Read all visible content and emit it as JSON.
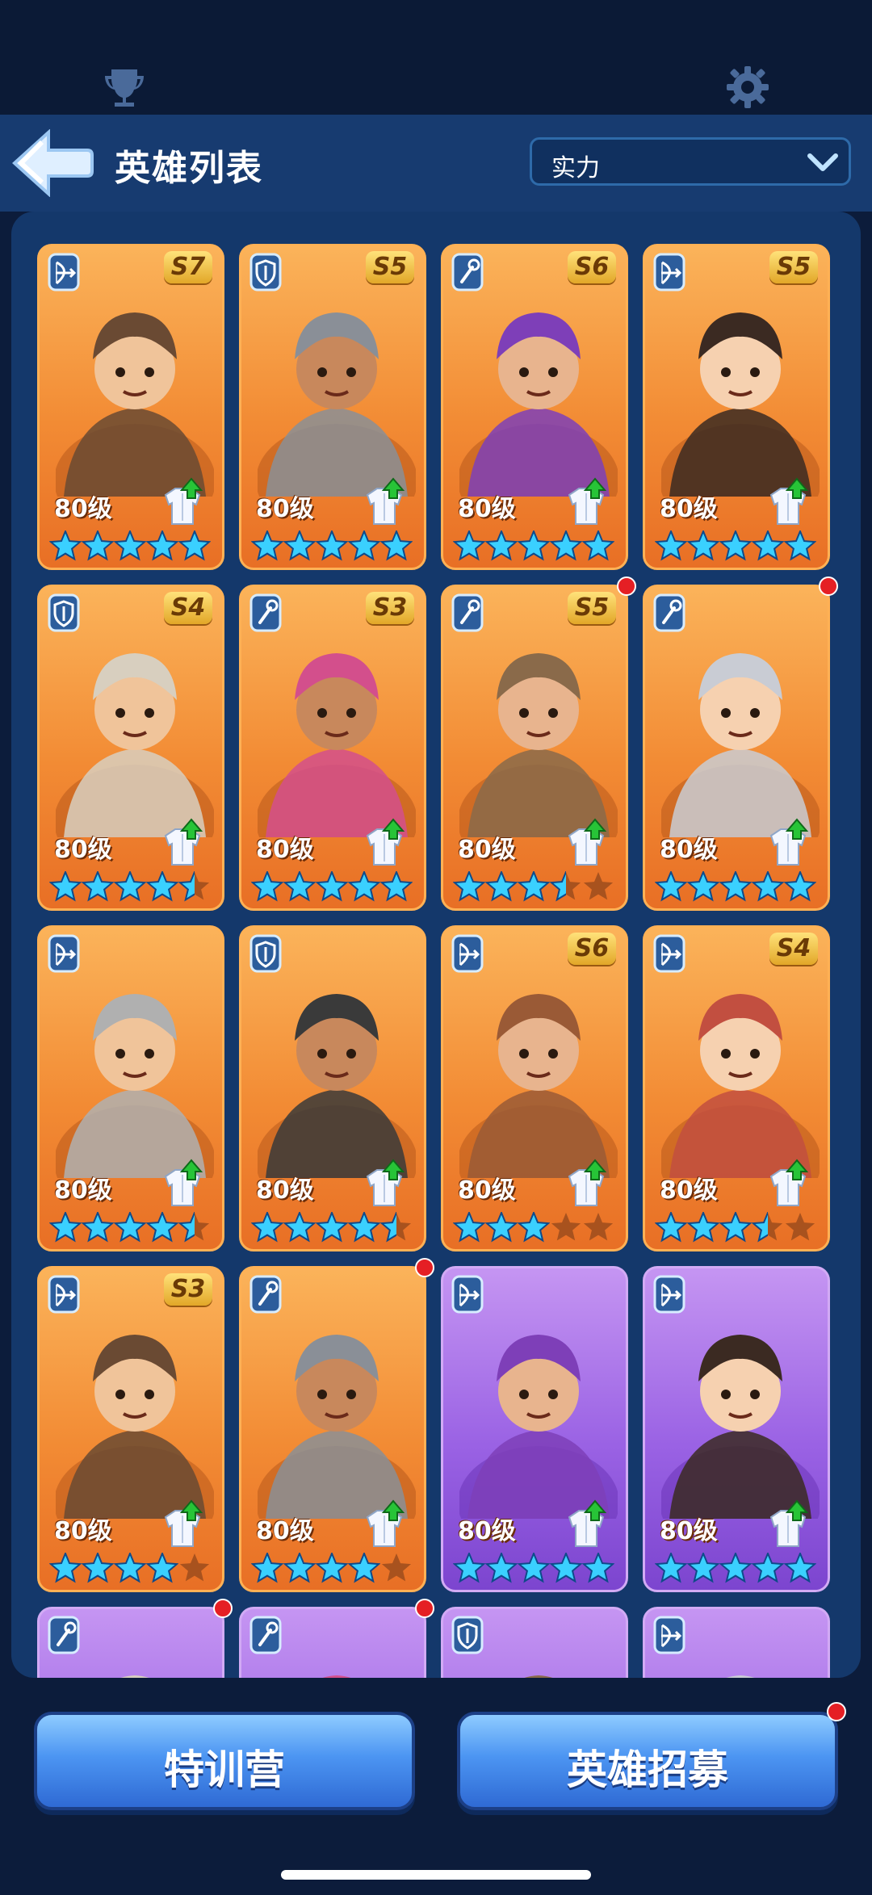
{
  "header": {
    "title": "英雄列表",
    "sort_value": "实力"
  },
  "buttons": {
    "training": "特训营",
    "recruit": "英雄招募"
  },
  "colors": {
    "accent": "#4c95f2",
    "card_orange": "#f28b34",
    "card_purple": "#9a62e4",
    "star": "#3ad0ff",
    "red_dot": "#e51f24"
  },
  "heroes": [
    {
      "role": "bow-icon",
      "tier": "S7",
      "level": "80级",
      "stars": 5,
      "rarity": "orange",
      "dot": false
    },
    {
      "role": "shield-icon",
      "tier": "S5",
      "level": "80级",
      "stars": 5,
      "rarity": "orange",
      "dot": false
    },
    {
      "role": "staff-icon",
      "tier": "S6",
      "level": "80级",
      "stars": 5,
      "rarity": "orange",
      "dot": false
    },
    {
      "role": "bow-icon",
      "tier": "S5",
      "level": "80级",
      "stars": 5,
      "rarity": "orange",
      "dot": false
    },
    {
      "role": "shield-icon",
      "tier": "S4",
      "level": "80级",
      "stars": 4.5,
      "rarity": "orange",
      "dot": false
    },
    {
      "role": "staff-icon",
      "tier": "S3",
      "level": "80级",
      "stars": 5,
      "rarity": "orange",
      "dot": false
    },
    {
      "role": "staff-icon",
      "tier": "S5",
      "level": "80级",
      "stars": 3.5,
      "rarity": "orange",
      "dot": true
    },
    {
      "role": "staff-icon",
      "tier": "",
      "level": "80级",
      "stars": 5,
      "rarity": "orange",
      "dot": true
    },
    {
      "role": "bow-icon",
      "tier": "",
      "level": "80级",
      "stars": 4.5,
      "rarity": "orange",
      "dot": false
    },
    {
      "role": "shield-icon",
      "tier": "",
      "level": "80级",
      "stars": 4.5,
      "rarity": "orange",
      "dot": false
    },
    {
      "role": "bow-icon",
      "tier": "S6",
      "level": "80级",
      "stars": 3,
      "rarity": "orange",
      "dot": false
    },
    {
      "role": "bow-icon",
      "tier": "S4",
      "level": "80级",
      "stars": 3.5,
      "rarity": "orange",
      "dot": false
    },
    {
      "role": "bow-icon",
      "tier": "S3",
      "level": "80级",
      "stars": 4,
      "rarity": "orange",
      "dot": false
    },
    {
      "role": "staff-icon",
      "tier": "",
      "level": "80级",
      "stars": 4,
      "rarity": "orange",
      "dot": true
    },
    {
      "role": "bow-icon",
      "tier": "",
      "level": "80级",
      "stars": 5,
      "rarity": "purple",
      "dot": false
    },
    {
      "role": "bow-icon",
      "tier": "",
      "level": "80级",
      "stars": 5,
      "rarity": "purple",
      "dot": false
    },
    {
      "role": "staff-icon",
      "tier": "",
      "level": "",
      "stars": 0,
      "rarity": "purple",
      "dot": true
    },
    {
      "role": "staff-icon",
      "tier": "",
      "level": "",
      "stars": 0,
      "rarity": "purple",
      "dot": true
    },
    {
      "role": "shield-icon",
      "tier": "",
      "level": "",
      "stars": 0,
      "rarity": "purple",
      "dot": false
    },
    {
      "role": "bow-icon",
      "tier": "",
      "level": "",
      "stars": 0,
      "rarity": "purple",
      "dot": false
    }
  ]
}
